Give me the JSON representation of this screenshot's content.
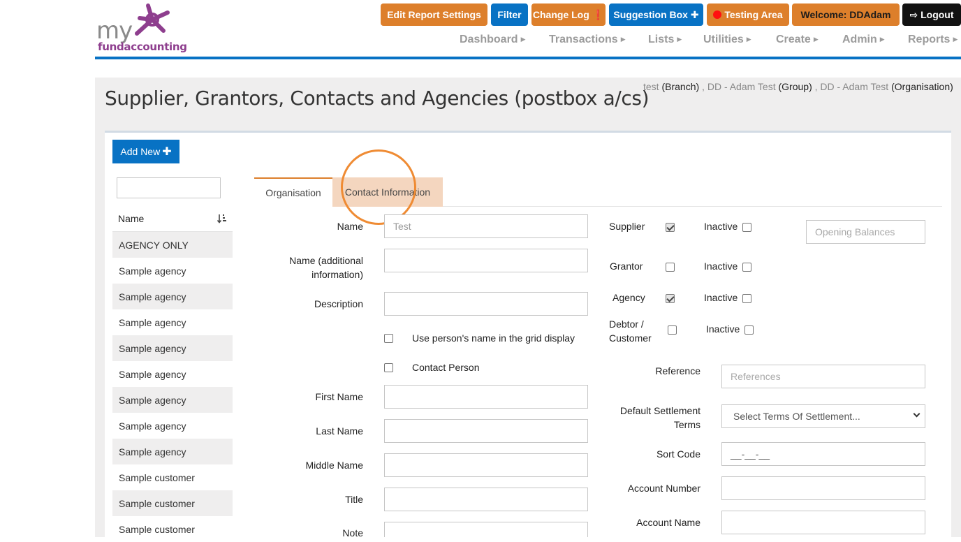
{
  "brand": {
    "logo_my": "my",
    "logo_name": "fundaccounting"
  },
  "topbar": {
    "edit_report_settings": "Edit Report Settings",
    "filter": "Filter",
    "change_log": "Change Log ❗",
    "suggestion_box": "Suggestion Box ✚",
    "testing_area": "Testing Area",
    "welcome": "Welcome:  DDAdam",
    "logout": "⇨ Logout"
  },
  "nav": [
    "Dashboard",
    "Transactions",
    "Lists",
    "Utilities",
    "Create",
    "Admin",
    "Reports"
  ],
  "page": {
    "title": "Supplier, Grantors, Contacts and Agencies (postbox a/cs)",
    "breadcrumb": [
      {
        "name": "test",
        "type": "(Branch)"
      },
      {
        "name": "DD - Adam Test",
        "type": "(Group)"
      },
      {
        "name": "DD - Adam Test",
        "type": "(Organisation)"
      }
    ]
  },
  "sidebar": {
    "add_new_label": "Add New",
    "search_value": "",
    "column_header": "Name",
    "items": [
      "AGENCY ONLY",
      "Sample agency",
      "Sample agency",
      "Sample agency",
      "Sample agency",
      "Sample agency",
      "Sample agency",
      "Sample agency",
      "Sample agency",
      "Sample customer",
      "Sample customer",
      "Sample customer"
    ]
  },
  "tabs": [
    {
      "label": "Organisation",
      "active": true
    },
    {
      "label": "Contact Information",
      "active": false,
      "highlighted": true
    }
  ],
  "form": {
    "name_label": "Name",
    "name_value": "Test",
    "name_additional_label": "Name (additional information)",
    "description_label": "Description",
    "use_person_name_label": "Use person's name in the grid display",
    "use_person_name_checked": false,
    "contact_person_label": "Contact Person",
    "contact_person_checked": false,
    "first_name_label": "First Name",
    "last_name_label": "Last Name",
    "middle_name_label": "Middle Name",
    "title_label": "Title",
    "note_label": "Note",
    "supplier_label": "Supplier",
    "supplier_checked": true,
    "grantor_label": "Grantor",
    "grantor_checked": false,
    "agency_label": "Agency",
    "agency_checked": true,
    "debtor_label": "Debtor / Customer",
    "debtor_checked": false,
    "inactive_label": "Inactive",
    "opening_balances_placeholder": "Opening Balances",
    "reference_label": "Reference",
    "reference_placeholder": "References",
    "default_settlement_label": "Default Settlement Terms",
    "settlement_selected": "Select Terms Of Settlement...",
    "sort_code_label": "Sort Code",
    "sort_code_value": "__-__-__",
    "account_number_label": "Account Number",
    "account_name_label": "Account Name"
  },
  "colors": {
    "accent_blue": "#0872c4",
    "accent_orange": "#dd7f2b",
    "highlight_ring": "#ef8b33",
    "testing_dot": "#ff1010"
  }
}
